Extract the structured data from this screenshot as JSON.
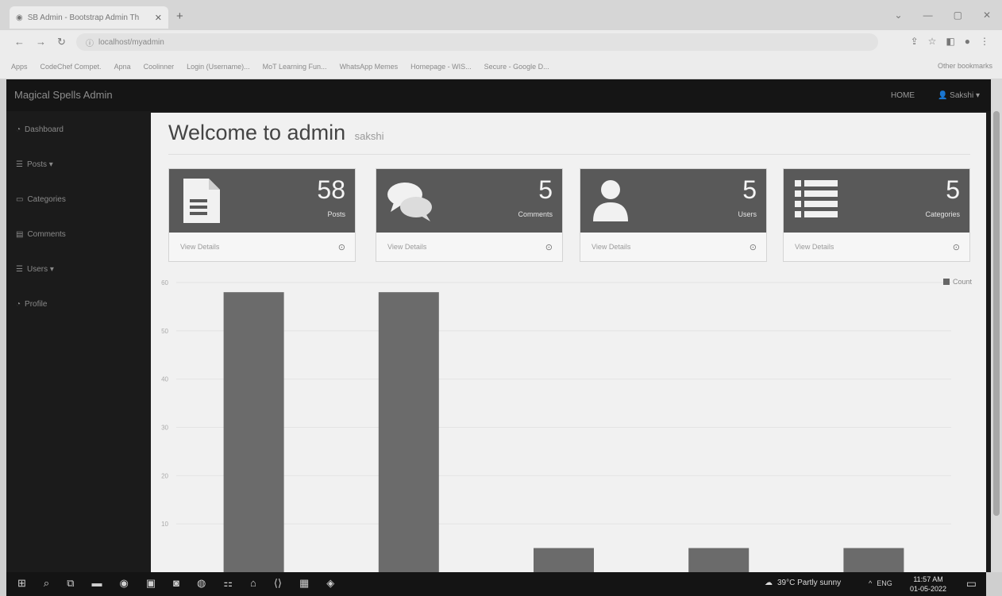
{
  "browser": {
    "tab_title": "SB Admin - Bootstrap Admin Th",
    "tab_close": "✕",
    "new_tab": "+",
    "address": "localhost/myadmin",
    "bookmarks": [
      "Apps",
      "CodeChef Compet.",
      "Apna",
      "Coolinner",
      "Login (Username)...",
      "MoT Learning Fun...",
      "WhatsApp Memes",
      "Homepage - WIS...",
      "Secure - Google D..."
    ],
    "other_bookmarks": "Other bookmarks"
  },
  "admin": {
    "brand": "Magical Spells Admin",
    "nav_home": "HOME",
    "nav_user": "Sakshi",
    "welcome_title": "Welcome to admin",
    "welcome_user": "sakshi"
  },
  "sidebar": {
    "items": [
      {
        "icon": "dashboard-icon",
        "glyph": "◔",
        "label": "Dashboard"
      },
      {
        "icon": "list-icon",
        "glyph": "☰",
        "label": "Posts ▾"
      },
      {
        "icon": "comment-icon",
        "glyph": "▭",
        "label": "Categories"
      },
      {
        "icon": "file-icon",
        "glyph": "▤",
        "label": "Comments"
      },
      {
        "icon": "list-icon",
        "glyph": "☰",
        "label": "Users ▾"
      },
      {
        "icon": "dashboard-icon",
        "glyph": "◔",
        "label": "Profile"
      }
    ]
  },
  "cards": [
    {
      "icon": "document-icon",
      "count": "58",
      "label": "Posts",
      "footer": "View Details"
    },
    {
      "icon": "comments-icon",
      "count": "5",
      "label": "Comments",
      "footer": "View Details"
    },
    {
      "icon": "user-icon",
      "count": "5",
      "label": "Users",
      "footer": "View Details"
    },
    {
      "icon": "list-icon",
      "count": "5",
      "label": "Categories",
      "footer": "View Details"
    }
  ],
  "colors": {
    "card_header": "#595959",
    "bar": "#6b6b6b",
    "sidebar_bg": "#1b1b1b",
    "content_bg": "#f1f1f1"
  },
  "chart_data": {
    "type": "bar",
    "categories": [
      "",
      "",
      "",
      "",
      ""
    ],
    "series": [
      {
        "name": "Count",
        "values": [
          58,
          58,
          5,
          5,
          5
        ]
      }
    ],
    "yticks": [
      "60",
      "50",
      "40",
      "30",
      "20",
      "10"
    ],
    "ylim": [
      0,
      60
    ],
    "legend": "top-right",
    "grid": true
  },
  "taskbar": {
    "weather": "39°C Partly sunny",
    "lang": "ENG",
    "time": "11:57 AM",
    "date": "01-05-2022"
  }
}
